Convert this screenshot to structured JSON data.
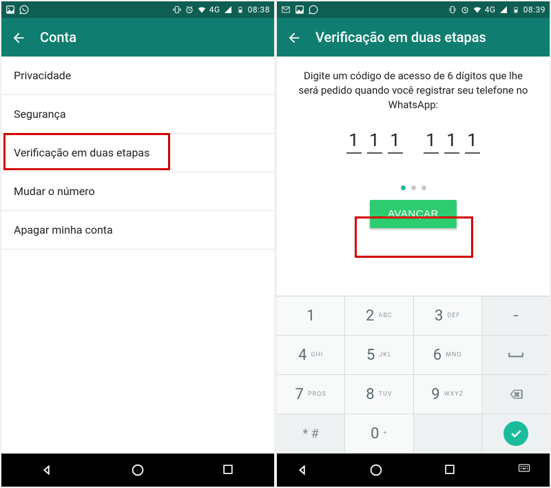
{
  "left": {
    "statusbar": {
      "time": "08:38",
      "network": "4G"
    },
    "appbar": {
      "title": "Conta"
    },
    "menu": {
      "items": [
        {
          "label": "Privacidade"
        },
        {
          "label": "Segurança"
        },
        {
          "label": "Verificação em duas etapas"
        },
        {
          "label": "Mudar o número"
        },
        {
          "label": "Apagar minha conta"
        }
      ]
    }
  },
  "right": {
    "statusbar": {
      "time": "08:39",
      "network": "4G"
    },
    "appbar": {
      "title": "Verificação em duas etapas"
    },
    "instructions": "Digite um código de acesso de 6 dígitos que lhe será pedido quando você registrar seu telefone no WhatsApp:",
    "pin": [
      "1",
      "1",
      "1",
      "1",
      "1",
      "1"
    ],
    "button": "AVANÇAR",
    "keypad": {
      "rows": [
        [
          {
            "num": "1",
            "letters": ""
          },
          {
            "num": "2",
            "letters": "ABC"
          },
          {
            "num": "3",
            "letters": "DEF"
          },
          {
            "util": "-"
          }
        ],
        [
          {
            "num": "4",
            "letters": "GHI"
          },
          {
            "num": "5",
            "letters": "JKL"
          },
          {
            "num": "6",
            "letters": "MNO"
          },
          {
            "util": "space"
          }
        ],
        [
          {
            "num": "7",
            "letters": "PRQS"
          },
          {
            "num": "8",
            "letters": "TUV"
          },
          {
            "num": "9",
            "letters": "WXYZ"
          },
          {
            "util": "backspace"
          }
        ],
        [
          {
            "util": "* #"
          },
          {
            "num": "0",
            "letters": "+"
          },
          {
            "util": ""
          },
          {
            "util": "done"
          }
        ]
      ]
    }
  },
  "colors": {
    "primary": "#0f7e70",
    "accent": "#2ecc71",
    "highlight": "#d40000"
  }
}
